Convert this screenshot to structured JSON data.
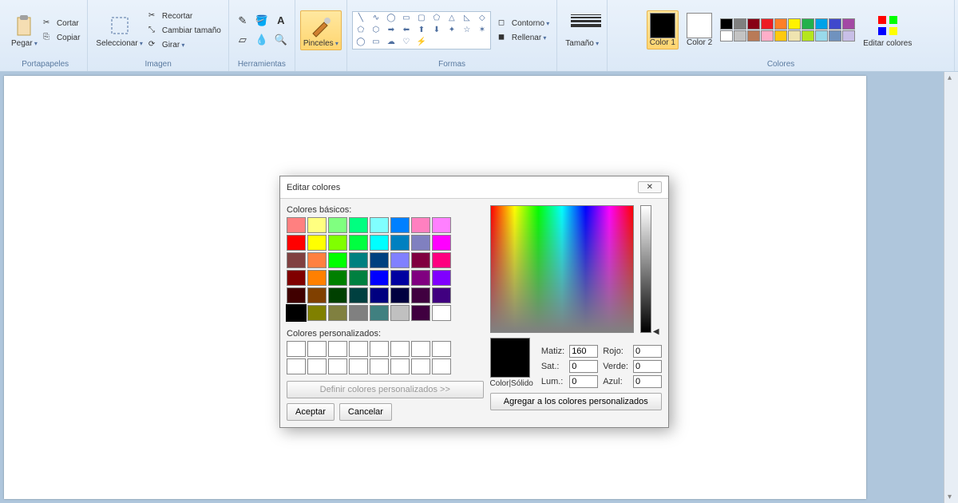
{
  "ribbon": {
    "clipboard": {
      "paste": "Pegar",
      "cut": "Cortar",
      "copy": "Copiar",
      "label": "Portapapeles"
    },
    "image": {
      "select": "Seleccionar",
      "crop": "Recortar",
      "resize": "Cambiar tamaño",
      "rotate": "Girar",
      "label": "Imagen"
    },
    "tools": {
      "label": "Herramientas"
    },
    "brushes": {
      "brushes": "Pinceles"
    },
    "shapes": {
      "outline": "Contorno",
      "fill": "Rellenar",
      "label": "Formas"
    },
    "size": {
      "size": "Tamaño"
    },
    "colors": {
      "color1": "Color 1",
      "color2": "Color 2",
      "edit": "Editar colores",
      "label": "Colores"
    },
    "palette": [
      "#000000",
      "#7f7f7f",
      "#880015",
      "#ed1c24",
      "#ff7f27",
      "#fff200",
      "#22b14c",
      "#00a2e8",
      "#3f48cc",
      "#a349a4",
      "#ffffff",
      "#c3c3c3",
      "#b97a57",
      "#ffaec9",
      "#ffc90e",
      "#efe4b0",
      "#b5e61d",
      "#99d9ea",
      "#7092be",
      "#c8bfe7"
    ]
  },
  "dialog": {
    "title": "Editar colores",
    "basic_label": "Colores básicos:",
    "custom_label": "Colores personalizados:",
    "define": "Definir colores personalizados >>",
    "ok": "Aceptar",
    "cancel": "Cancelar",
    "color_solid": "Color|Sólido",
    "hue": "Matiz:",
    "sat": "Sat.:",
    "lum": "Lum.:",
    "red": "Rojo:",
    "green": "Verde:",
    "blue": "Azul:",
    "add": "Agregar a los colores personalizados",
    "values": {
      "hue": "160",
      "sat": "0",
      "lum": "0",
      "red": "0",
      "green": "0",
      "blue": "0"
    },
    "basic_colors": [
      "#ff8080",
      "#ffff80",
      "#80ff80",
      "#00ff80",
      "#80ffff",
      "#0080ff",
      "#ff80c0",
      "#ff80ff",
      "#ff0000",
      "#ffff00",
      "#80ff00",
      "#00ff40",
      "#00ffff",
      "#0080c0",
      "#8080c0",
      "#ff00ff",
      "#804040",
      "#ff8040",
      "#00ff00",
      "#008080",
      "#004080",
      "#8080ff",
      "#800040",
      "#ff0080",
      "#800000",
      "#ff8000",
      "#008000",
      "#008040",
      "#0000ff",
      "#0000a0",
      "#800080",
      "#8000ff",
      "#400000",
      "#804000",
      "#004000",
      "#004040",
      "#000080",
      "#000040",
      "#400040",
      "#400080",
      "#000000",
      "#808000",
      "#808040",
      "#808080",
      "#408080",
      "#c0c0c0",
      "#400040",
      "#ffffff"
    ]
  }
}
